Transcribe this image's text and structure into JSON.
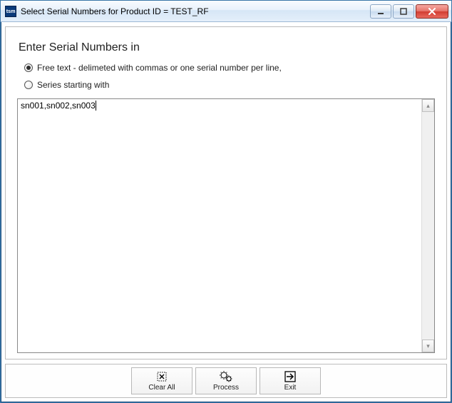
{
  "app_icon_text": "tsm",
  "window_title": "Select Serial Numbers for Product ID = TEST_RF",
  "heading": "Enter Serial Numbers in",
  "radios": {
    "free_text": "Free text - delimeted with commas or one serial number per line,",
    "series": "Series starting with"
  },
  "selected_radio": "free_text",
  "textarea_value": "sn001,sn002,sn003",
  "toolbar": {
    "clear": "Clear All",
    "process": "Process",
    "exit": "Exit"
  }
}
